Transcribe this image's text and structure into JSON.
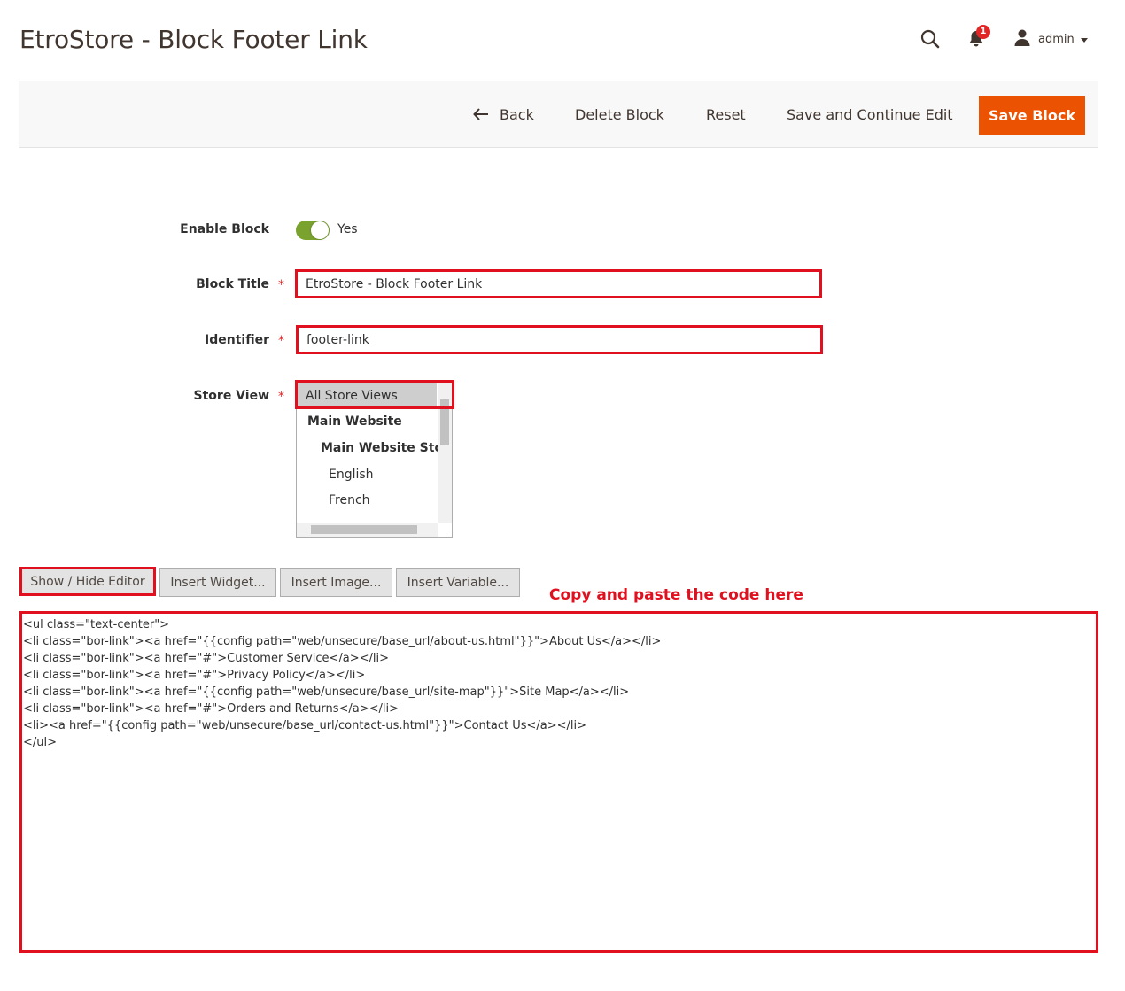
{
  "header": {
    "title": "EtroStore - Block Footer Link",
    "notifications_count": "1",
    "user_name": "admin"
  },
  "actions": {
    "back": "Back",
    "delete": "Delete Block",
    "reset": "Reset",
    "save_continue": "Save and Continue Edit",
    "save": "Save Block"
  },
  "form": {
    "enable_label": "Enable Block",
    "enable_value": "Yes",
    "title_label": "Block Title",
    "title_value": "EtroStore - Block Footer Link",
    "identifier_label": "Identifier",
    "identifier_value": "footer-link",
    "store_label": "Store View",
    "required_mark": "*",
    "store_options": [
      "All Store Views",
      "Main Website",
      "Main Website Store",
      "English",
      "French"
    ]
  },
  "editor": {
    "buttons": [
      "Show / Hide Editor",
      "Insert Widget...",
      "Insert Image...",
      "Insert Variable..."
    ],
    "annotation": "Copy and paste the code here",
    "code_lines": [
      "<ul class=\"text-center\">",
      "<li class=\"bor-link\"><a href=\"{{config path=\"web/unsecure/base_url/about-us.html\"}}\">About Us</a></li>",
      "<li class=\"bor-link\"><a href=\"#\">Customer Service</a></li>",
      "<li class=\"bor-link\"><a href=\"#\">Privacy Policy</a></li>",
      "<li class=\"bor-link\"><a href=\"{{config path=\"web/unsecure/base_url/site-map\"}}\">Site Map</a></li>",
      "<li class=\"bor-link\"><a href=\"#\">Orders and Returns</a></li>",
      "<li><a href=\"{{config path=\"web/unsecure/base_url/contact-us.html\"}}\">Contact Us</a></li>",
      "</ul>"
    ]
  },
  "colors": {
    "accent": "#eb5202",
    "highlight": "#e0101e",
    "toggle_on": "#79a22e"
  }
}
